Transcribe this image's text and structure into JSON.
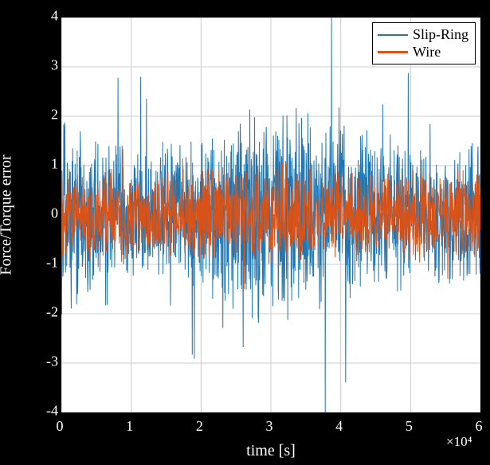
{
  "chart_data": {
    "type": "line",
    "title": "",
    "xlabel": "time [s]",
    "ylabel": "Force/Torque error",
    "xlim": [
      0,
      60000
    ],
    "ylim": [
      -4,
      4
    ],
    "x_multiplier_label": "×10⁴",
    "x_ticks": [
      0,
      10000,
      20000,
      30000,
      40000,
      50000,
      60000
    ],
    "x_tick_labels": [
      "0",
      "1",
      "2",
      "3",
      "4",
      "5",
      "6"
    ],
    "y_ticks": [
      -4,
      -3,
      -2,
      -1,
      0,
      1,
      2,
      3,
      4
    ],
    "y_tick_labels": [
      "-4",
      "-3",
      "-2",
      "-1",
      "0",
      "1",
      "2",
      "3",
      "4"
    ],
    "series": [
      {
        "name": "Slip-Ring",
        "color": "#1f77b4",
        "description": "dense noisy signal roughly between -2.5 and 2.5 with occasional spikes to ±4"
      },
      {
        "name": "Wire",
        "color": "#d95319",
        "description": "dense noisy signal roughly between -1.2 and 1.2"
      }
    ],
    "legend_position": "top-right"
  },
  "legend": {
    "items": [
      {
        "label": "Slip-Ring",
        "color": "#1f77b4"
      },
      {
        "label": "Wire",
        "color": "#d95319"
      }
    ]
  }
}
